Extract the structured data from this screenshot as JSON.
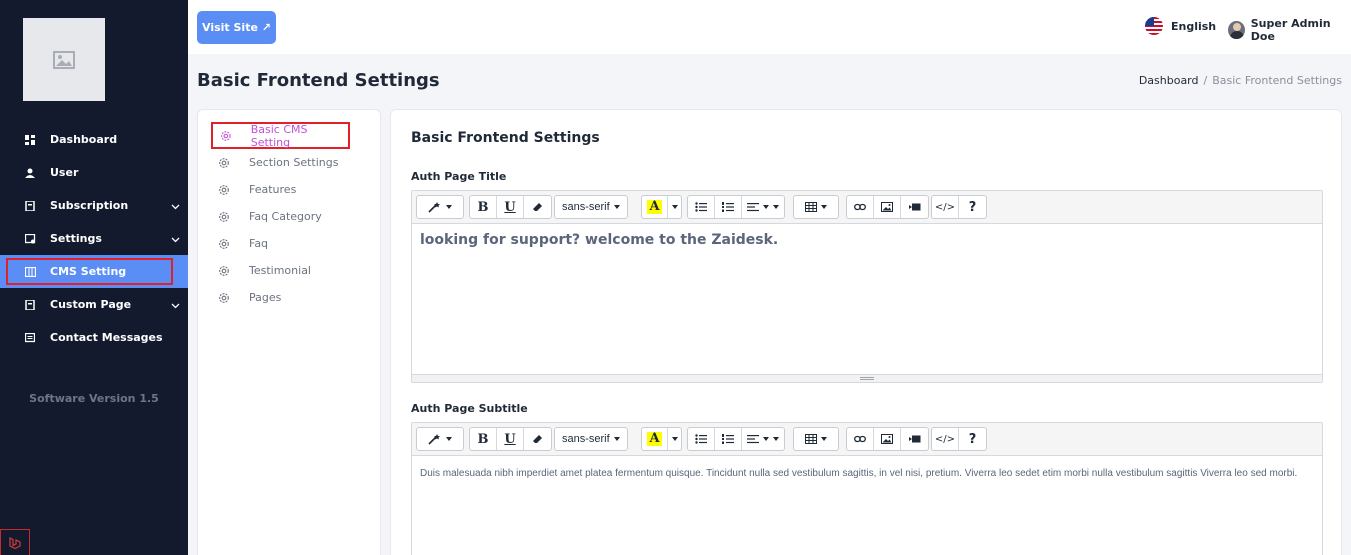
{
  "sidebar": {
    "items": [
      {
        "label": "Dashboard",
        "icon": "dashboard-icon",
        "has_chevron": false
      },
      {
        "label": "User",
        "icon": "user-icon",
        "has_chevron": false
      },
      {
        "label": "Subscription",
        "icon": "subscription-icon",
        "has_chevron": true
      },
      {
        "label": "Settings",
        "icon": "settings-icon",
        "has_chevron": true
      },
      {
        "label": "CMS Setting",
        "icon": "cms-icon",
        "has_chevron": false,
        "active": true
      },
      {
        "label": "Custom Page",
        "icon": "page-icon",
        "has_chevron": true
      },
      {
        "label": "Contact Messages",
        "icon": "message-icon",
        "has_chevron": false
      }
    ],
    "version": "Software Version 1.5"
  },
  "topbar": {
    "visit_site": "Visit Site ↗",
    "language": "English",
    "user_name": "Super Admin Doe"
  },
  "page": {
    "title": "Basic Frontend Settings",
    "breadcrumb": {
      "home": "Dashboard",
      "separator": "/",
      "current": "Basic Frontend Settings"
    }
  },
  "settings_menu": {
    "items": [
      {
        "label": "Basic CMS Setting",
        "active": true
      },
      {
        "label": "Section Settings"
      },
      {
        "label": "Features"
      },
      {
        "label": "Faq Category"
      },
      {
        "label": "Faq"
      },
      {
        "label": "Testimonial"
      },
      {
        "label": "Pages"
      }
    ]
  },
  "main": {
    "card_title": "Basic Frontend Settings",
    "fields": [
      {
        "label": "Auth Page Title",
        "content": "looking for support? welcome to the Zaidesk."
      },
      {
        "label": "Auth Page Subtitle",
        "content": "Duis malesuada nibh imperdiet amet platea fermentum quisque. Tincidunt nulla sed vestibulum sagittis, in vel nisi, pretium. Viverra leo sedet etim morbi nulla vestibulum sagittis Viverra leo sed morbi."
      }
    ],
    "toolbar": {
      "font_family": "sans-serif",
      "bold": "B",
      "underline": "U",
      "help": "?",
      "code": "</>"
    }
  },
  "colors": {
    "sidebar_bg": "#141a2e",
    "accent": "#5b8ef5",
    "active_menu_text": "#c44fd6",
    "highlight_border": "#e0212a"
  }
}
